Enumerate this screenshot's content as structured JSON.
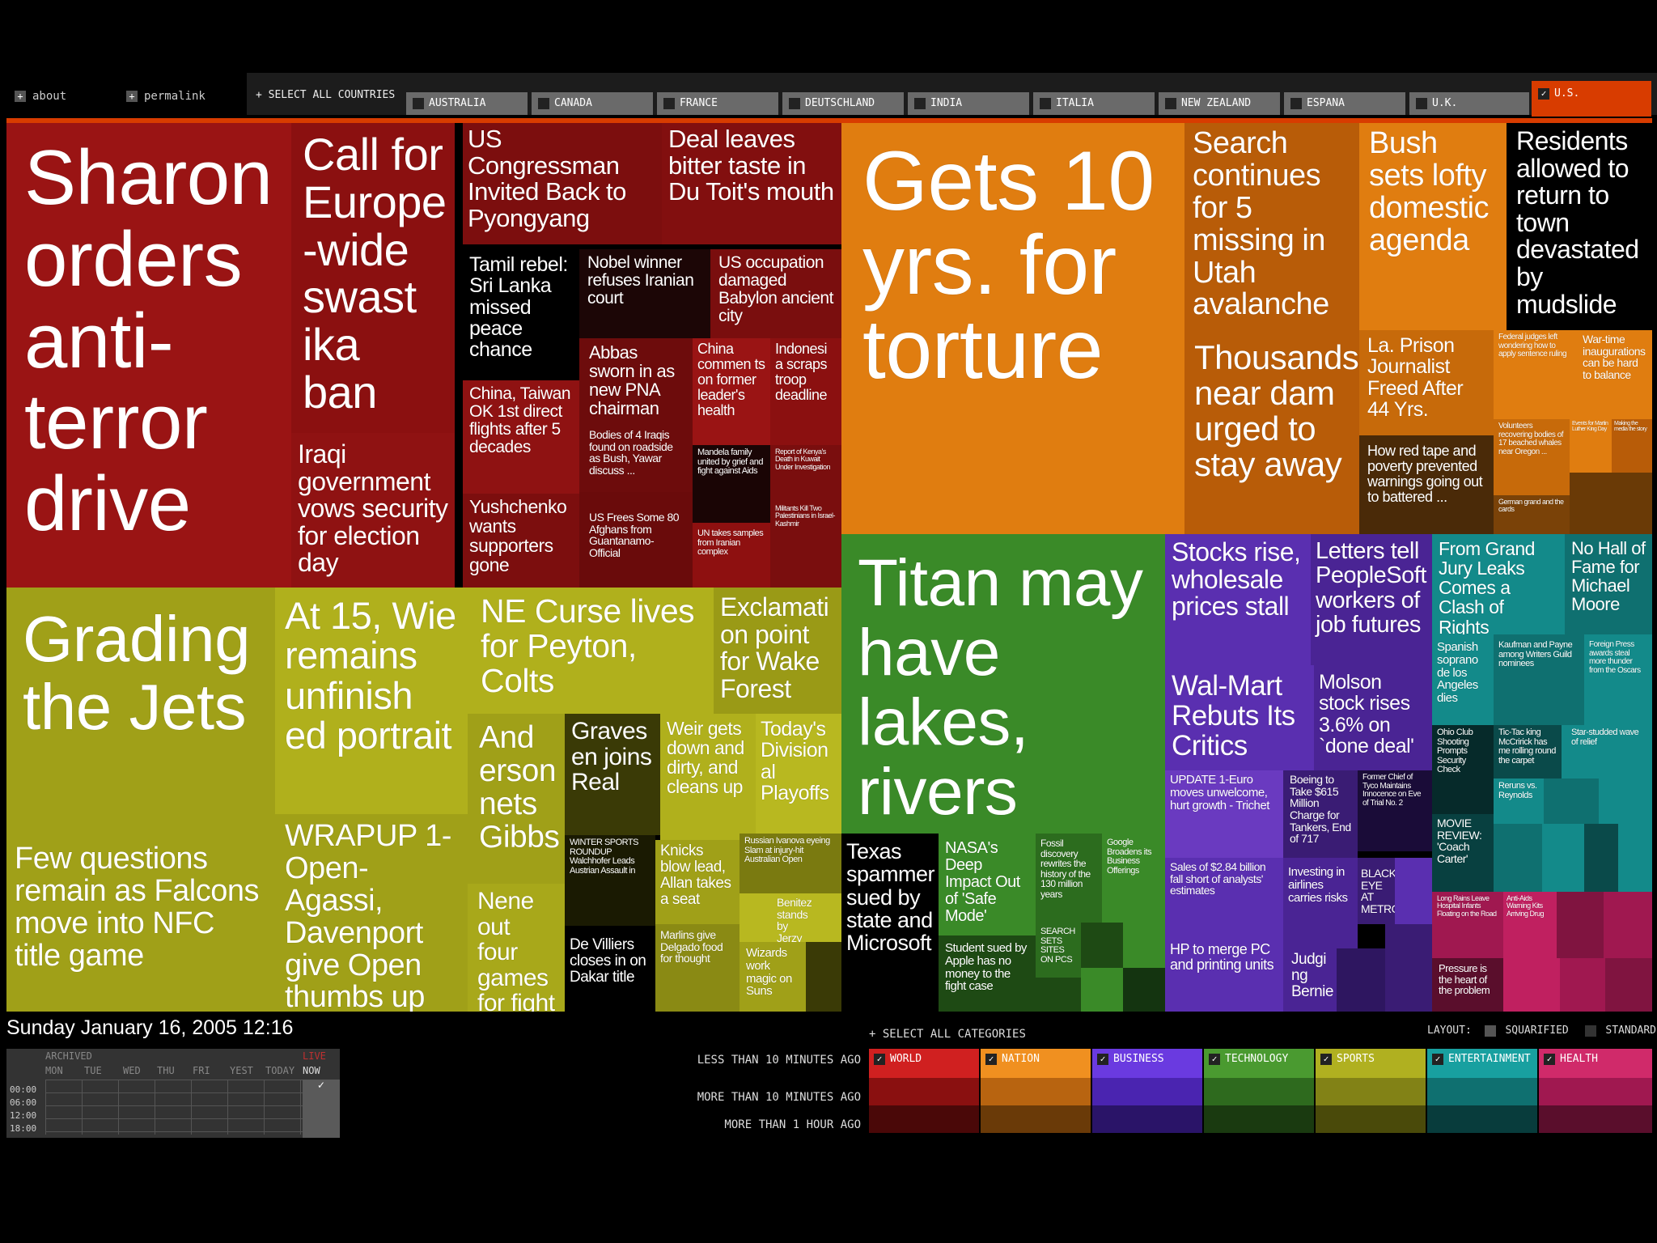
{
  "topbar": {
    "about_label": "about",
    "permalink_label": "permalink",
    "select_all_countries": "SELECT ALL COUNTRIES",
    "countries": [
      "AUSTRALIA",
      "CANADA",
      "FRANCE",
      "DEUTSCHLAND",
      "INDIA",
      "ITALIA",
      "NEW ZEALAND",
      "ESPANA",
      "U.K.",
      "U.S."
    ],
    "selected_country": "U.S.",
    "current_tag": "US",
    "plus_glyph": "+",
    "check_glyph": "✓"
  },
  "colors": {
    "world": "#8e1010",
    "nation": "#e07d10",
    "business": "#5a2fb0",
    "technology": "#3a8a28",
    "sports": "#a0a018",
    "entertainment": "#138a8a",
    "health": "#c02060",
    "accent": "#d83c00"
  },
  "stories": {
    "s1": "Sharon orders anti-terror drive",
    "s2": "Call for Europe -wide swast ika ban",
    "s3": "US Congressman Invited Back to Pyongyang",
    "s4": "Deal leaves bitter taste in Du Toit's mouth",
    "s5": "Tamil rebel: Sri Lanka missed peace chance",
    "s6": "Nobel winner refuses Iranian court",
    "s7": "US occupation damaged Babylon ancient city",
    "s8": "Abbas sworn in as new PNA chairman",
    "s9": "China commen ts on former leader's health",
    "s10": "Indonesi a scraps troop deadline",
    "s11": "China, Taiwan OK 1st direct flights after 5 decades",
    "s12": "Bodies of 4 Iraqis found on roadside as Bush, Yawar discuss ...",
    "s13": "Mandela family united by grief and fight against Aids",
    "s14": "Report of Kenya's Death in Kuwait Under Investigation",
    "s15": "Iraqi government vows security for election day",
    "s16": "Yushchenko wants supporters gone",
    "s17": "US Frees Some 80 Afghans from Guantanamo- Official",
    "s18": "UN takes samples from Iranian complex",
    "s19": "Militants Kill Two Palestinians in Israel-Kashmir",
    "n1": "Gets 10 yrs. for torture",
    "n2": "Search continues for 5 missing in Utah avalanche",
    "n3": "Bush sets lofty domestic agenda",
    "n4": "Residents allowed to return to town devastated by mudslide",
    "n5": "Thousands near dam urged to stay away",
    "n6": "La. Prison Journalist Freed After 44 Yrs.",
    "n7": "Federal judges left wondering how to apply sentence ruling",
    "n8": "War-time inaugurations can be hard to balance",
    "n9": "How red tape and poverty prevented warnings going out to battered ...",
    "n10": "Volunteers recovering bodies of 17 beached whales near Oregon ...",
    "n11": "Events for Martin Luther King Day",
    "n12": "Making the media the story",
    "n13": "German grand and the cards",
    "sp1": "Grading the Jets",
    "sp2": "At 15, Wie remains unfinish ed portrait",
    "sp3": "NE Curse lives for Peyton, Colts",
    "sp4": "Exclamati on point for Wake Forest",
    "sp5": "And erson nets Gibbs",
    "sp6": "Graves en joins Real",
    "sp7": "Weir gets down and dirty, and cleans up",
    "sp8": "Today's Division al Playoffs",
    "sp9": "Few questions remain as Falcons move into NFC title game",
    "sp10": "WRAPUP 1-Open-Agassi, Davenport give Open thumbs up",
    "sp11": "Nene out four games for fight",
    "sp12": "WINTER SPORTS ROUNDUP Walchhofer Leads Austrian Assault in",
    "sp13": "Knicks blow lead, Allan takes a seat",
    "sp14": "Russian Ivanova eyeing Slam at injury-hit Australian Open",
    "sp15": "Benitez stands by Jerzy",
    "sp16": "De Villiers closes in on Dakar title",
    "sp17": "Marlins give Delgado food for thought",
    "sp18": "Wizards work magic on Suns",
    "t1": "Titan may have lakes, rivers",
    "t2": "Texas spammer sued by state and Microsoft",
    "t3": "NASA's Deep Impact Out of 'Safe Mode'",
    "t4": "Fossil discovery rewrites the history of the 130 million years",
    "t5": "Google Broadens its Business Offerings",
    "t6": "Student sued by Apple has no money to the fight case",
    "t7": "SEARCH SETS SITES ON PCS",
    "b1": "Stocks rise, wholesale prices stall",
    "b2": "Letters tell PeopleSoft workers of job futures",
    "b3": "Wal-Mart Rebuts Its Critics",
    "b4": "Molson stock rises 3.6% on `done deal'",
    "b5": "UPDATE 1-Euro moves unwelcome, hurt growth - Trichet",
    "b6": "Boeing to Take $615 Million Charge for Tankers, End of 717",
    "b7": "Former Chief of Tyco Maintains Innocence on Eve of Trial No. 2",
    "b8": "Sales of $2.84 billion fall short of analysts' estimates",
    "b9": "Investing in airlines carries risks",
    "b10": "BLACK EYE AT METRO",
    "b11": "HP to merge PC and printing units",
    "b12": "Judgi ng Bernie",
    "e1": "From Grand Jury Leaks Comes a Clash of Rights",
    "e2": "No Hall of Fame for Michael Moore",
    "e3": "Spanish soprano de los Angeles dies",
    "e4": "Kaufman and Payne among Writers Guild nominees",
    "e5": "Foreign Press awards steal more thunder from the Oscars",
    "e6": "Ohio Club Shooting Prompts Security Check",
    "e7": "Tic-Tac king McCririck has me rolling round the carpet",
    "e8": "Star-studded wave of relief",
    "e9": "MOVIE REVIEW: 'Coach Carter'",
    "e10": "Reruns vs. Reynolds",
    "h1": "Long Rains Leave Hospital Infants Floating on the Road",
    "h2": "Anti-Aids Warning Kits Arriving Drug",
    "h3": "Pressure is the heart of the problem"
  },
  "footer": {
    "datetime": "Sunday January 16, 2005 12:16",
    "archived_label": "ARCHIVED",
    "live_label": "LIVE",
    "days": [
      "MON",
      "TUE",
      "WED",
      "THU",
      "FRI",
      "YEST",
      "TODAY",
      "NOW"
    ],
    "hours": [
      "00:00",
      "06:00",
      "12:00",
      "18:00"
    ],
    "select_all_categories": "SELECT ALL CATEGORIES",
    "layout_label": "LAYOUT:",
    "layout_squarified": "SQUARIFIED",
    "layout_standard": "STANDARD",
    "categories": [
      "WORLD",
      "NATION",
      "BUSINESS",
      "TECHNOLOGY",
      "SPORTS",
      "ENTERTAINMENT",
      "HEALTH"
    ],
    "legend": [
      "LESS THAN 10 MINUTES AGO",
      "MORE THAN 10 MINUTES AGO",
      "MORE THAN 1 HOUR AGO"
    ]
  }
}
